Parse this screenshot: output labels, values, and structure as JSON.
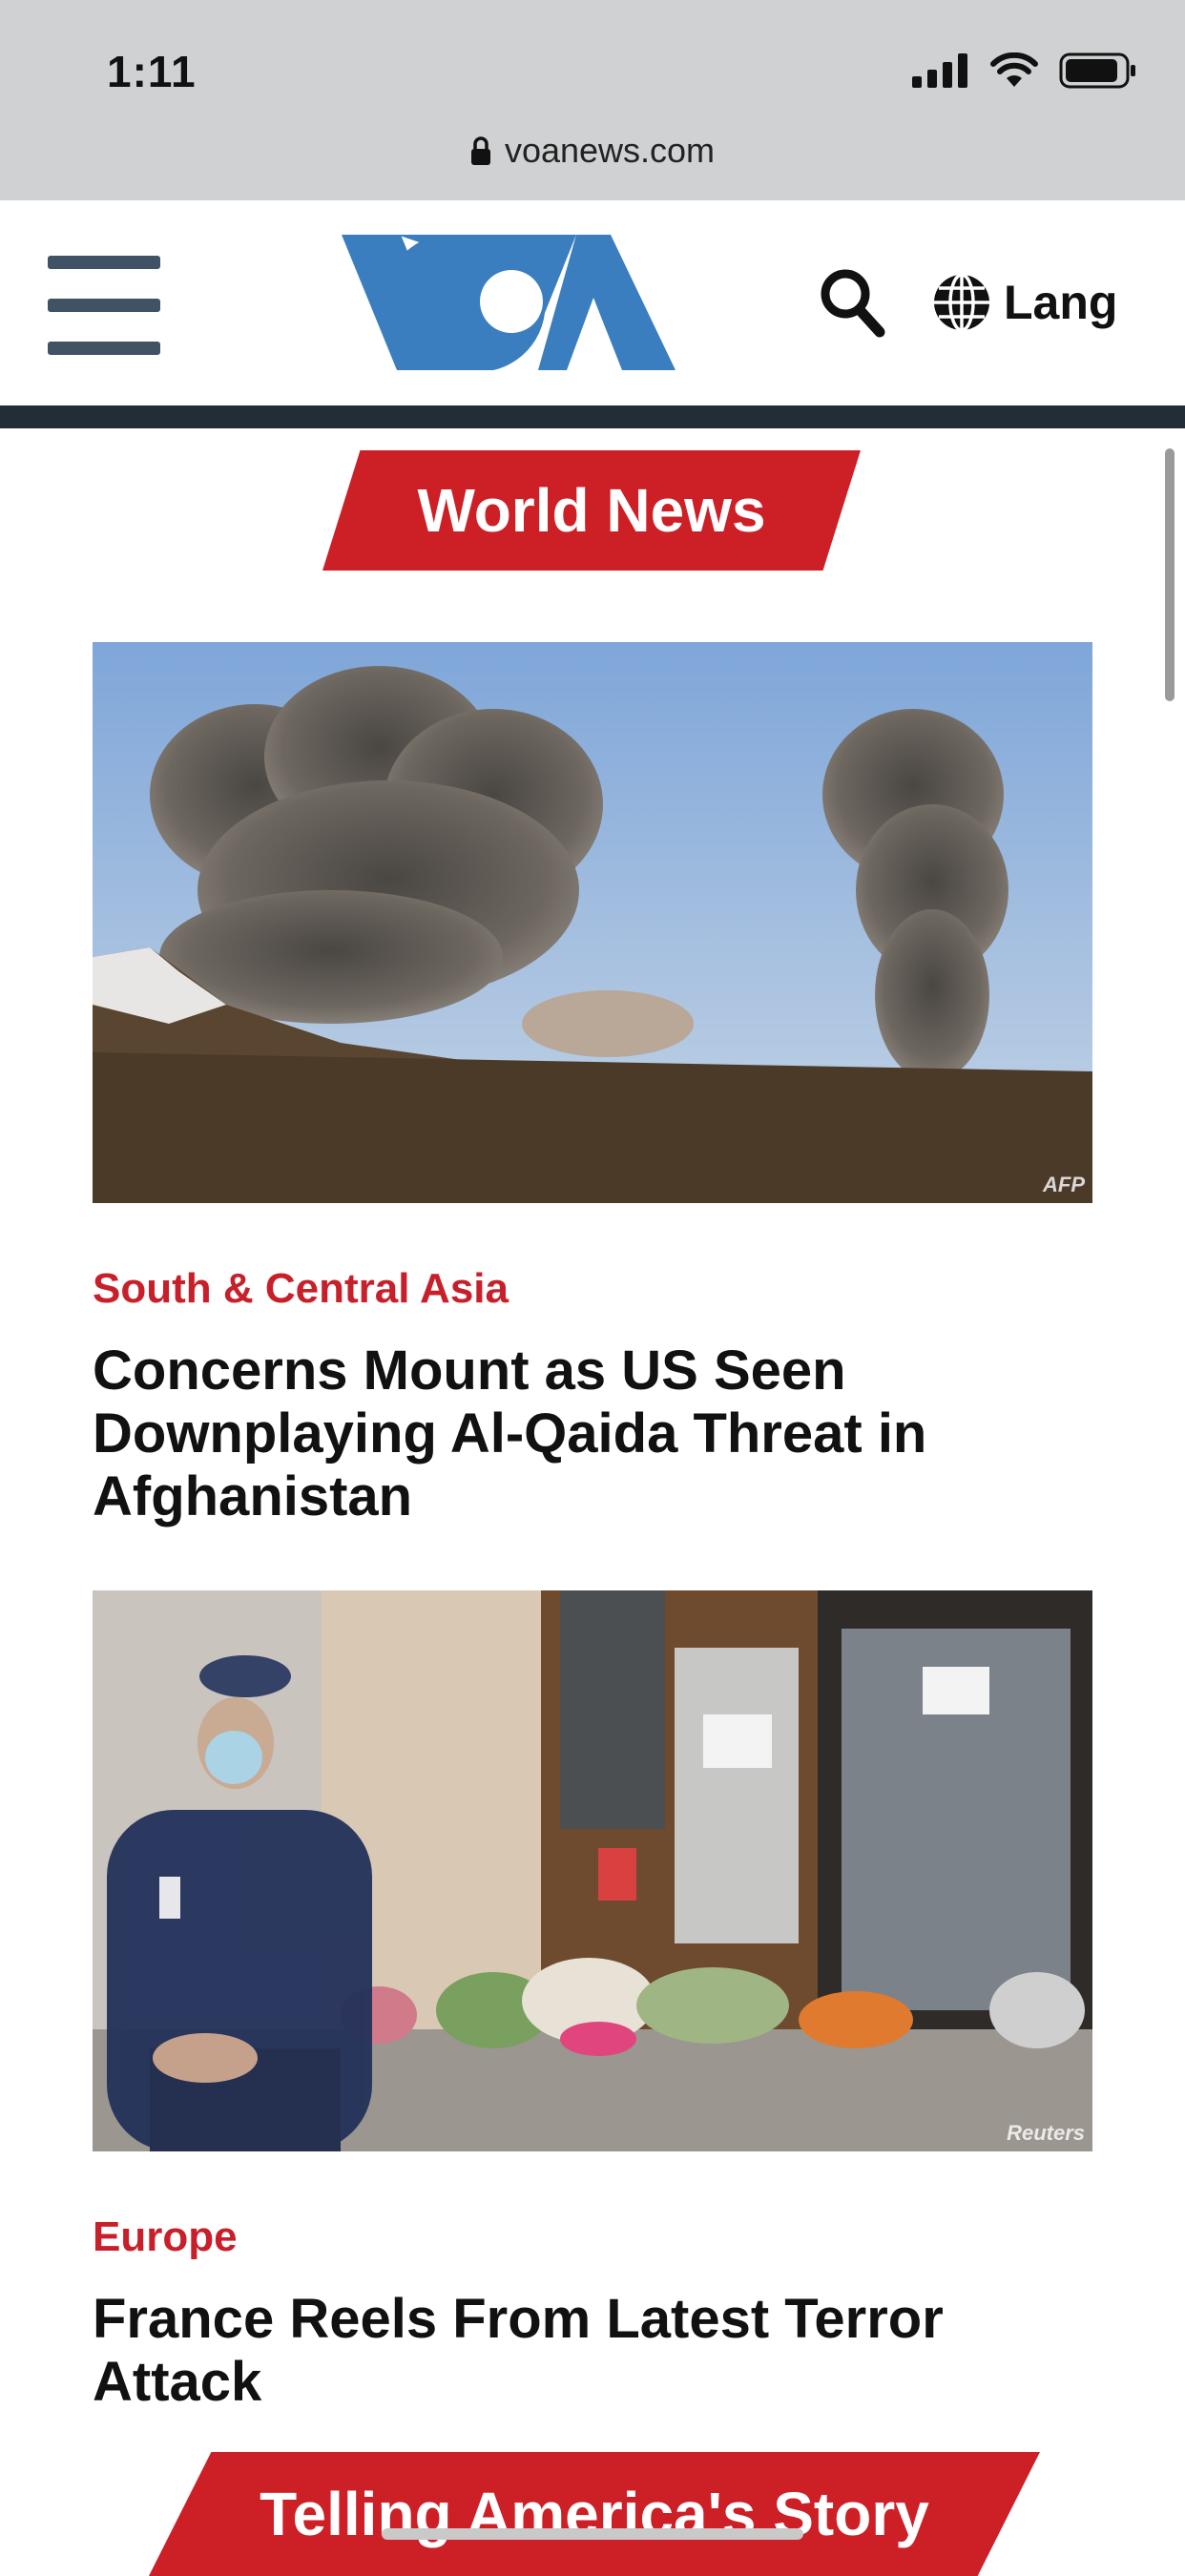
{
  "status_bar": {
    "time": "1:11"
  },
  "browser": {
    "url": "voanews.com"
  },
  "header": {
    "lang_label": "Lang"
  },
  "sections": {
    "world_news": "World News",
    "telling_story": "Telling America's Story"
  },
  "articles": [
    {
      "credit": "AFP",
      "category": "South & Central Asia",
      "headline": "Concerns Mount as US Seen Downplaying Al-Qaida Threat in Afghanistan"
    },
    {
      "credit": "Reuters",
      "category": "Europe",
      "headline": "France Reels From Latest Terror Attack"
    }
  ],
  "colors": {
    "brand_blue": "#3a7ebf",
    "accent_red": "#cd1f26",
    "header_rule": "#232d37"
  }
}
